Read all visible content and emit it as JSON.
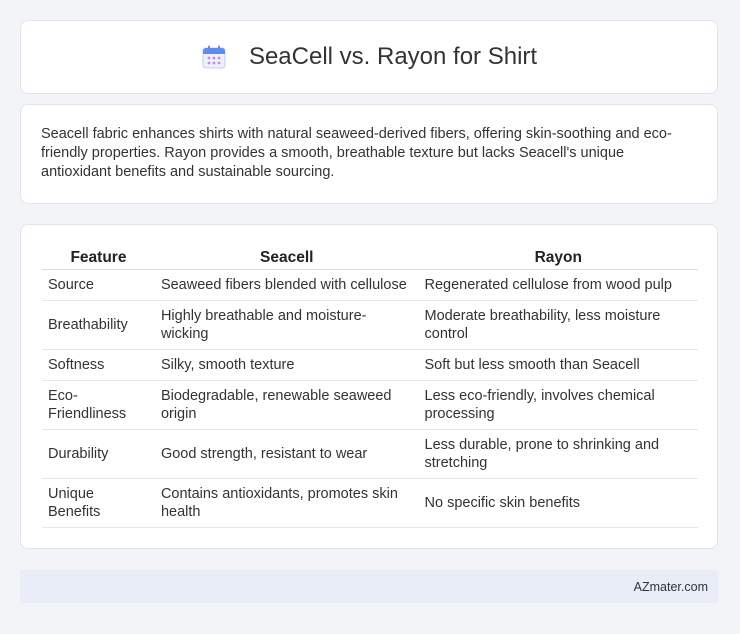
{
  "header": {
    "title": "SeaCell vs. Rayon for Shirt",
    "icon": "calendar-icon"
  },
  "intro": {
    "text": "Seacell fabric enhances shirts with natural seaweed-derived fibers, offering skin-soothing and eco-friendly properties. Rayon provides a smooth, breathable texture but lacks Seacell's unique antioxidant benefits and sustainable sourcing."
  },
  "table": {
    "headers": [
      "Feature",
      "Seacell",
      "Rayon"
    ],
    "rows": [
      [
        "Source",
        "Seaweed fibers blended with cellulose",
        "Regenerated cellulose from wood pulp"
      ],
      [
        "Breathability",
        "Highly breathable and moisture-wicking",
        "Moderate breathability, less moisture control"
      ],
      [
        "Softness",
        "Silky, smooth texture",
        "Soft but less smooth than Seacell"
      ],
      [
        "Eco-Friendliness",
        "Biodegradable, renewable seaweed origin",
        "Less eco-friendly, involves chemical processing"
      ],
      [
        "Durability",
        "Good strength, resistant to wear",
        "Less durable, prone to shrinking and stretching"
      ],
      [
        "Unique Benefits",
        "Contains antioxidants, promotes skin health",
        "No specific skin benefits"
      ]
    ]
  },
  "footer": {
    "brand": "AZmater.com"
  }
}
